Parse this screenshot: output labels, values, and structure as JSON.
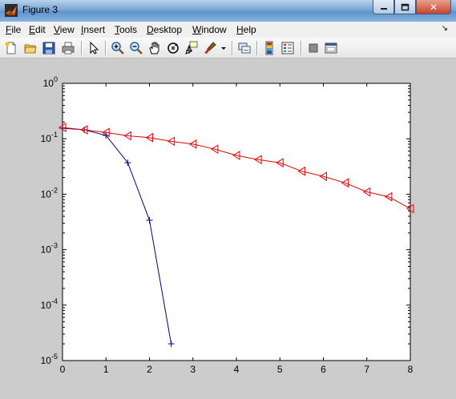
{
  "window": {
    "title": "Figure 3",
    "controls": {
      "close_glyph": "✕"
    }
  },
  "menu": [
    {
      "label": "File",
      "accel": "F"
    },
    {
      "label": "Edit",
      "accel": "E"
    },
    {
      "label": "View",
      "accel": "V"
    },
    {
      "label": "Insert",
      "accel": "I"
    },
    {
      "label": "Tools",
      "accel": "T"
    },
    {
      "label": "Desktop",
      "accel": "D"
    },
    {
      "label": "Window",
      "accel": "W"
    },
    {
      "label": "Help",
      "accel": "H"
    }
  ],
  "toolbar": {
    "icons": [
      "new-figure-icon",
      "open-file-icon",
      "save-icon",
      "print-icon",
      "edit-plot-arrow-icon",
      "zoom-in-icon",
      "zoom-out-icon",
      "pan-hand-icon",
      "rotate-3d-icon",
      "data-cursor-icon",
      "brush-icon",
      "brush-dropdown-icon",
      "link-plot-icon",
      "insert-colorbar-icon",
      "insert-legend-icon",
      "hide-plot-tools-icon",
      "show-plot-tools-icon"
    ]
  },
  "chart_data": {
    "type": "line",
    "title": "",
    "xlabel": "",
    "ylabel": "",
    "xlim": [
      0,
      8
    ],
    "ylim": [
      1e-05,
      1
    ],
    "yscale": "log",
    "grid": false,
    "x_ticks": [
      "0",
      "1",
      "2",
      "3",
      "4",
      "5",
      "6",
      "7",
      "8"
    ],
    "y_ticks": [
      {
        "base": "10",
        "exp": "-5",
        "value": 1e-05
      },
      {
        "base": "10",
        "exp": "-4",
        "value": 0.0001
      },
      {
        "base": "10",
        "exp": "-3",
        "value": 0.001
      },
      {
        "base": "10",
        "exp": "-2",
        "value": 0.01
      },
      {
        "base": "10",
        "exp": "-1",
        "value": 0.1
      },
      {
        "base": "10",
        "exp": "0",
        "value": 1
      }
    ],
    "series": [
      {
        "color": "#00008b",
        "marker": "plus",
        "x": [
          0,
          0.5,
          1,
          1.5,
          2,
          2.5
        ],
        "y": [
          0.155,
          0.145,
          0.115,
          0.037,
          0.0034,
          2e-05
        ]
      },
      {
        "color": "#ee0000",
        "marker": "triangle-left",
        "x": [
          0,
          0.5,
          1,
          1.5,
          2,
          2.5,
          3,
          3.5,
          4,
          4.5,
          5,
          5.5,
          6,
          6.5,
          7,
          7.5,
          8
        ],
        "y": [
          0.16,
          0.145,
          0.13,
          0.113,
          0.105,
          0.09,
          0.08,
          0.065,
          0.05,
          0.042,
          0.037,
          0.026,
          0.021,
          0.016,
          0.011,
          0.009,
          0.0055
        ]
      }
    ]
  }
}
